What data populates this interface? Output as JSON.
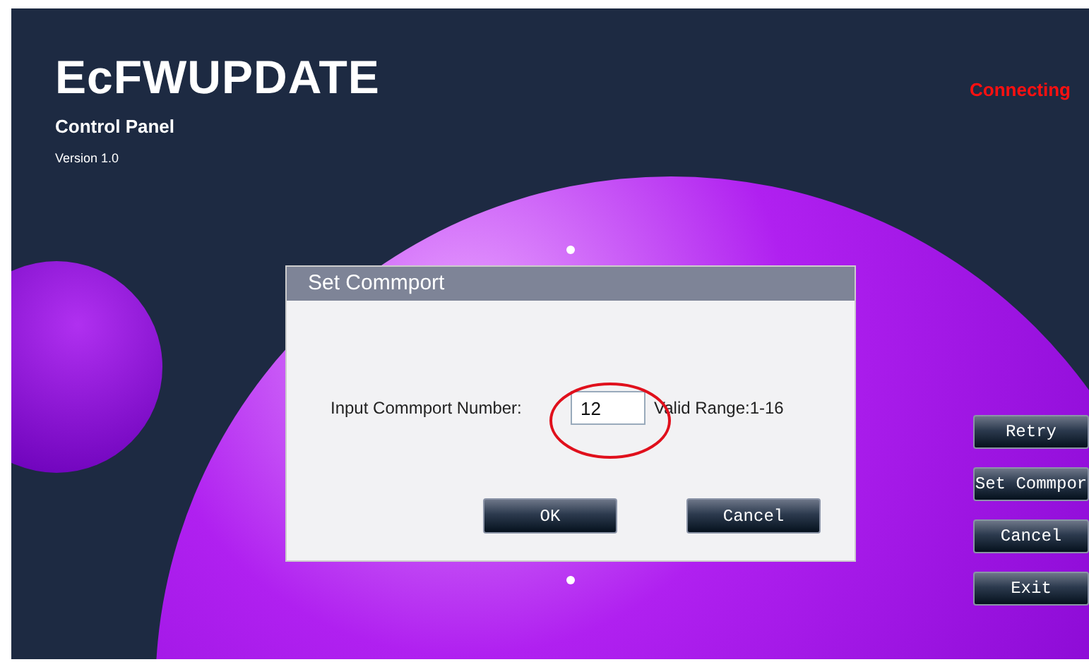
{
  "header": {
    "title": "EcFWUPDATE",
    "subtitle": "Control Panel",
    "version": "Version 1.0"
  },
  "status": {
    "text": "Connecting"
  },
  "dialog": {
    "title": "Set Commport",
    "field_label": "Input Commport Number:",
    "field_value": "12",
    "range_text": "Valid Range:1-16",
    "buttons": [
      "OK",
      "Cancel"
    ]
  },
  "side_buttons": [
    "Retry",
    "Set Commpor",
    "Cancel",
    "Exit"
  ]
}
